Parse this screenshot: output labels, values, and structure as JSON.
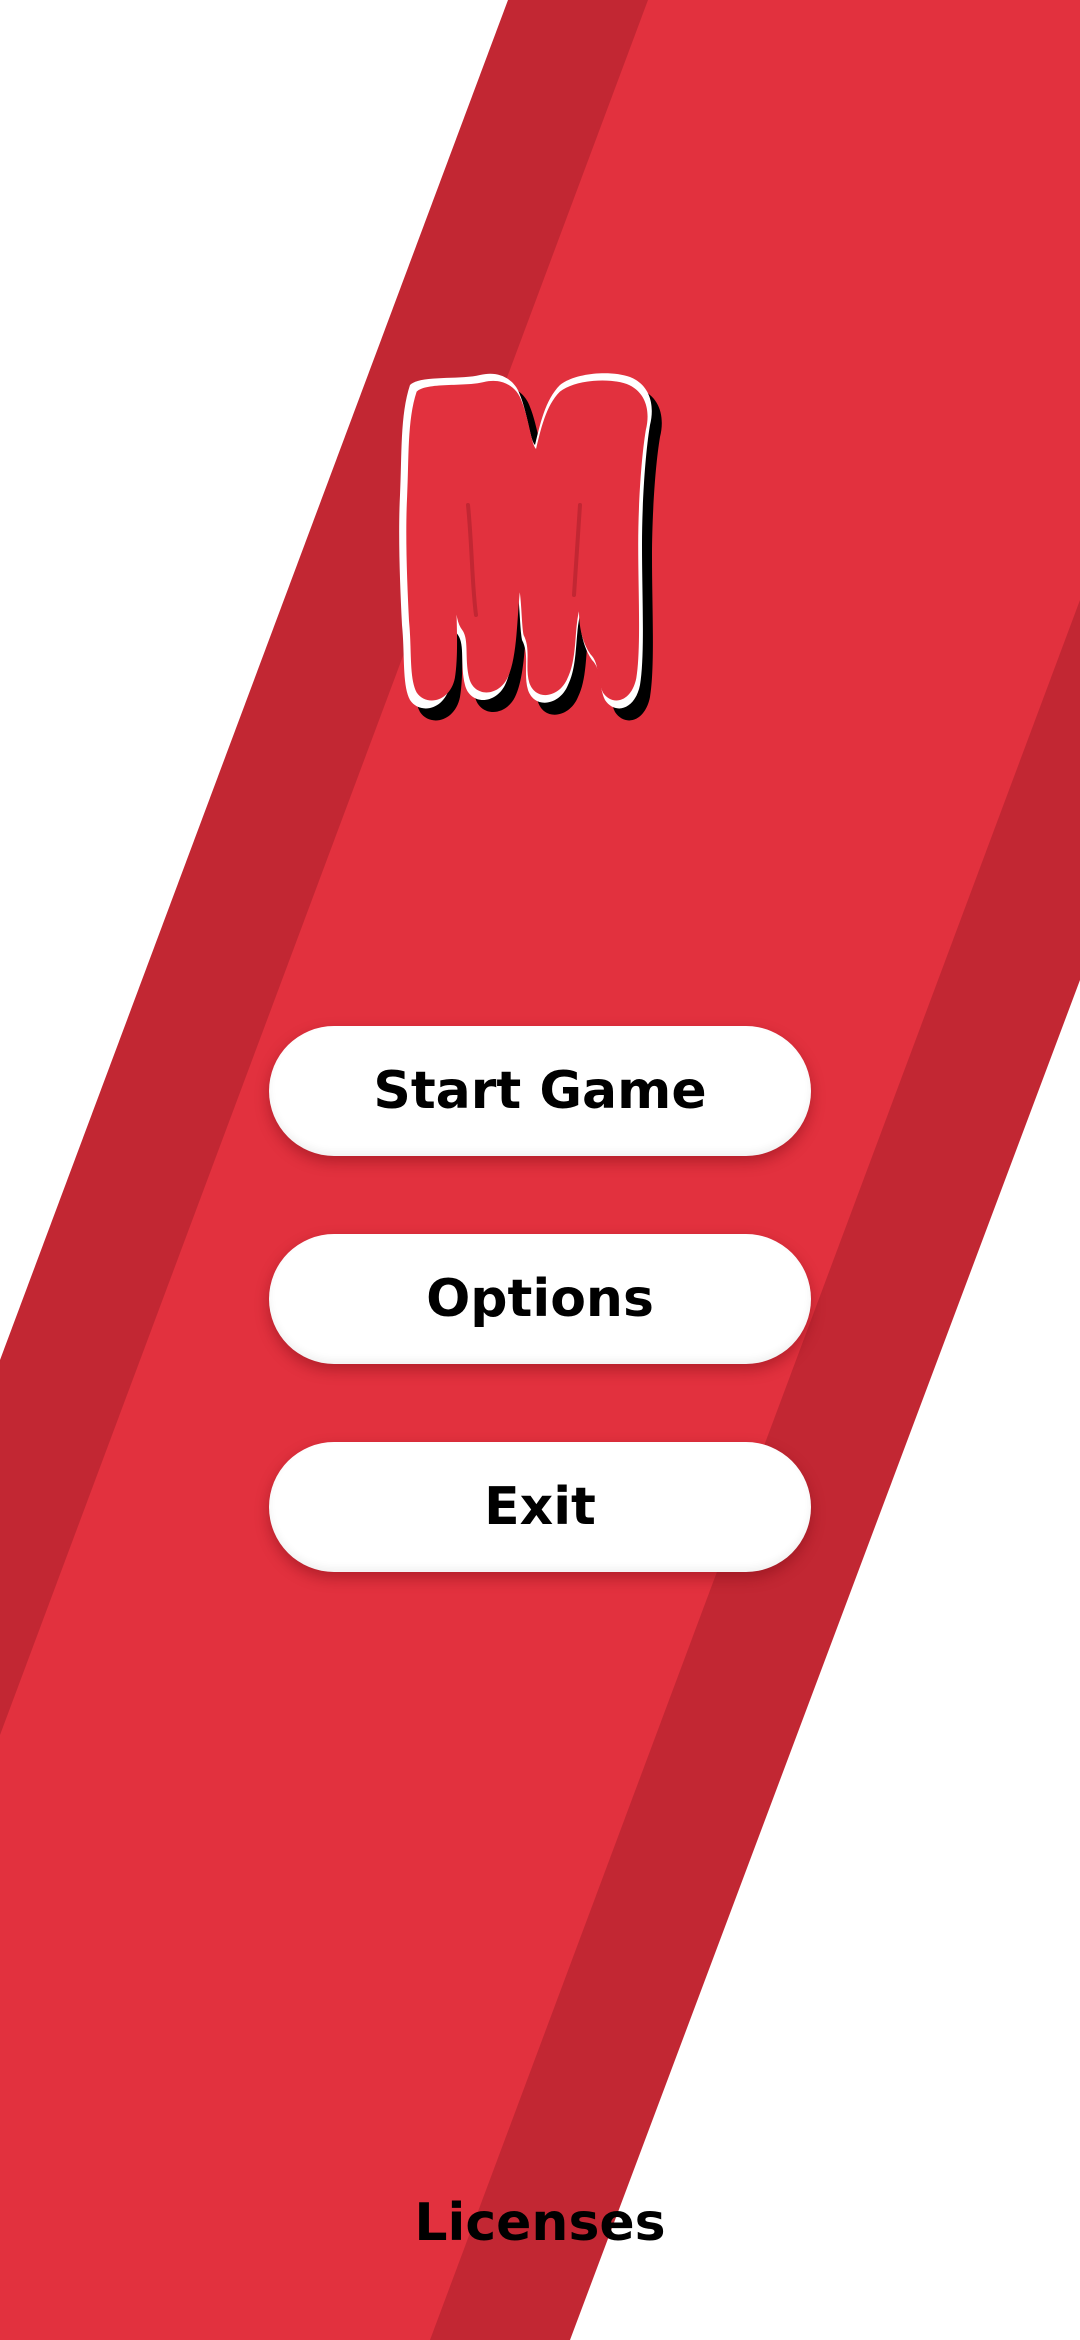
{
  "colors": {
    "background": "#ffffff",
    "stripe_dark": "#c22733",
    "stripe_main": "#e2313e",
    "logo_fill": "#e2313e",
    "button_bg": "#ffffff",
    "button_text": "#000000"
  },
  "logo": {
    "letter": "M"
  },
  "menu": {
    "start_label": "Start Game",
    "options_label": "Options",
    "exit_label": "Exit"
  },
  "footer": {
    "licenses_label": "Licenses"
  }
}
